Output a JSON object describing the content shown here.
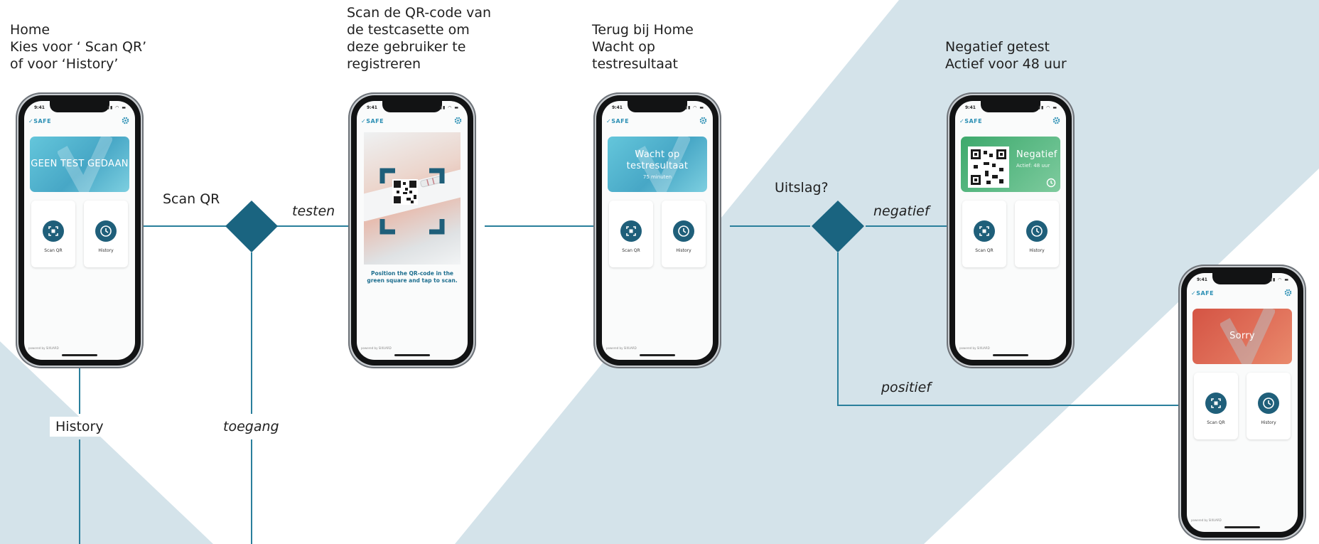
{
  "colors": {
    "line": "#2a7f9c",
    "diamond": "#1a6480",
    "band": "#d4e3ea",
    "accent": "#2b8fb4"
  },
  "steps": {
    "home": "Home\nKies voor ‘ Scan QR’\nof voor ‘History’",
    "scan": "Scan de QR-code van\nde testcasette om\ndeze gebruiker te\nregistreren",
    "wait": "Terug bij Home\nWacht op\ntestresultaat",
    "negative": "Negatief getest\nActief voor 48 uur"
  },
  "edges": {
    "scan_qr": "Scan QR",
    "testen": "testen",
    "toegang": "toegang",
    "history": "History",
    "uitslag": "Uitslag?",
    "negatief": "negatief",
    "positief": "positief"
  },
  "app": {
    "time": "9:41",
    "brand": "✓SAFE",
    "footer": "powered by SIXUARD",
    "scan_button": "Scan QR",
    "history_button": "History",
    "icons": {
      "settings": "gear-icon",
      "scan": "qr-scan-icon",
      "history": "history-icon",
      "clock": "clock-icon"
    }
  },
  "screens": {
    "home": {
      "status": "GEEN TEST GEDAAN"
    },
    "scanner": {
      "hint": "Position the QR-code in the green square and tap to scan."
    },
    "waiting": {
      "status": "Wacht op testresultaat",
      "sub": "75 minuten"
    },
    "negative": {
      "status": "Negatief",
      "sub": "Actief: 48 uur"
    },
    "positive": {
      "status": "Sorry"
    }
  }
}
